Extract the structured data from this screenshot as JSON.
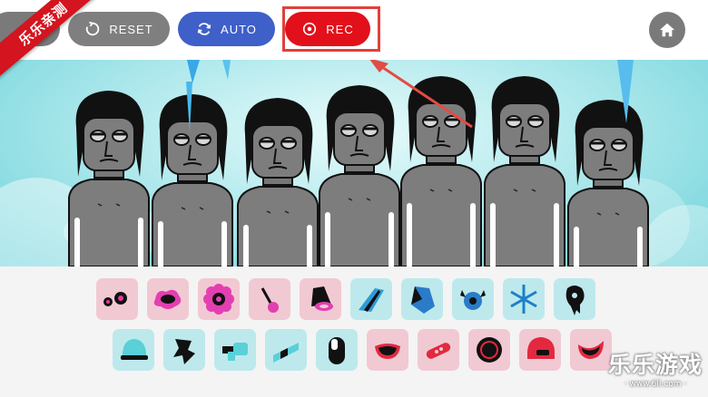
{
  "toolbar": {
    "reset_label": "RESET",
    "auto_label": "AUTO",
    "rec_label": "REC"
  },
  "corner_badge": "乐乐亲测",
  "watermark": {
    "title": "乐乐游戏",
    "url": "· www.6ll.com ·"
  },
  "colors": {
    "reset": "#7f7f7f",
    "auto": "#3f5fc9",
    "rec": "#e2101a",
    "home": "#7a7a7a",
    "pink_tile": "#f1c9d3",
    "blue_tile": "#bde9ec",
    "highlight": "#e0403c"
  },
  "sounds_row1": [
    {
      "icon": "pink-dots-icon",
      "color": "pink"
    },
    {
      "icon": "pink-splat-icon",
      "color": "pink"
    },
    {
      "icon": "pink-flower-icon",
      "color": "pink"
    },
    {
      "icon": "pink-lollipop-icon",
      "color": "pink"
    },
    {
      "icon": "pink-cone-icon",
      "color": "pink"
    },
    {
      "icon": "blue-shards-icon",
      "color": "blue"
    },
    {
      "icon": "blue-crystal-icon",
      "color": "blue"
    },
    {
      "icon": "blue-eye-horns-icon",
      "color": "blue"
    },
    {
      "icon": "blue-snowflake-icon",
      "color": "blue"
    },
    {
      "icon": "black-drip-icon",
      "color": "blue"
    }
  ],
  "sounds_row2": [
    {
      "icon": "cap-icon",
      "color": "blue"
    },
    {
      "icon": "jagged-shape-icon",
      "color": "blue"
    },
    {
      "icon": "pipe-icon",
      "color": "blue"
    },
    {
      "icon": "stripe-icon",
      "color": "blue"
    },
    {
      "icon": "capsule-icon",
      "color": "blue"
    },
    {
      "icon": "mouth-icon",
      "color": "pink"
    },
    {
      "icon": "bandage-icon",
      "color": "pink"
    },
    {
      "icon": "ball-icon",
      "color": "pink"
    },
    {
      "icon": "helmet-icon",
      "color": "pink"
    },
    {
      "icon": "smile-icon",
      "color": "pink"
    }
  ]
}
